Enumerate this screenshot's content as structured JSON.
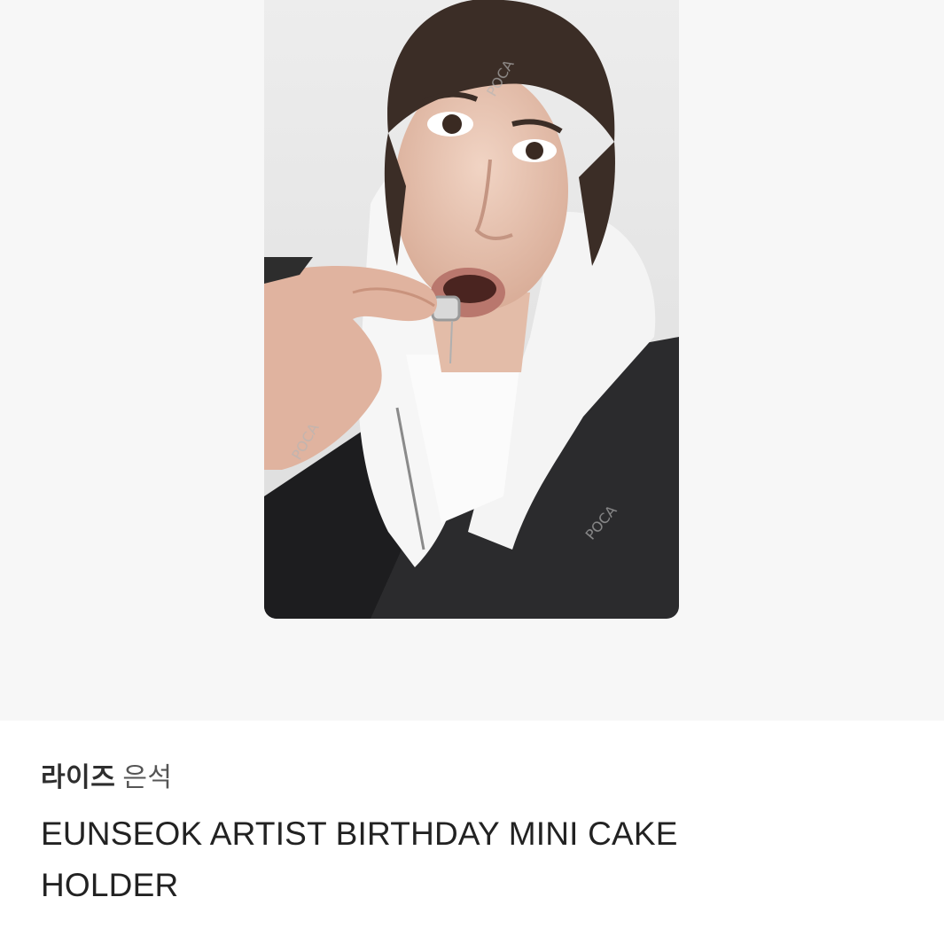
{
  "product": {
    "image_alt": "photocard",
    "group": "라이즈",
    "member": "은석",
    "title": "EUNSEOK ARTIST BIRTHDAY MINI CAKE HOLDER"
  },
  "watermark": {
    "text": "POCA"
  }
}
